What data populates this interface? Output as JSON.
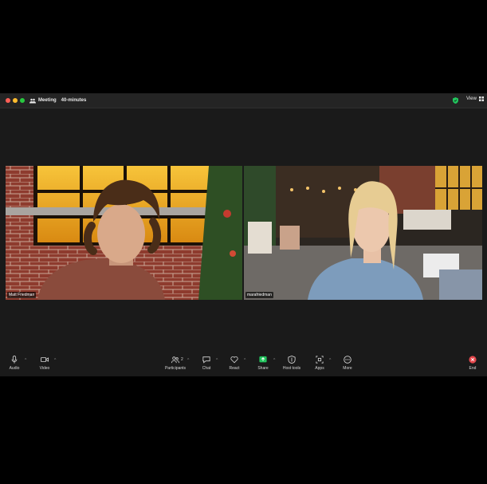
{
  "window": {
    "meeting_title": "Meeting",
    "timer": "40-minutes",
    "view_label": "View"
  },
  "participants": [
    {
      "name": "Matt Friedman"
    },
    {
      "name": "marafriedman"
    }
  ],
  "toolbar": {
    "audio": "Audio",
    "video": "Video",
    "participants": "Participants",
    "participants_count": "2",
    "chat": "Chat",
    "react": "React",
    "share": "Share",
    "host_tools": "Host tools",
    "apps": "Apps",
    "more": "More",
    "end": "End"
  },
  "colors": {
    "share_green": "#22c55e",
    "end_red": "#e5484d",
    "encryption_green": "#22c55e"
  }
}
